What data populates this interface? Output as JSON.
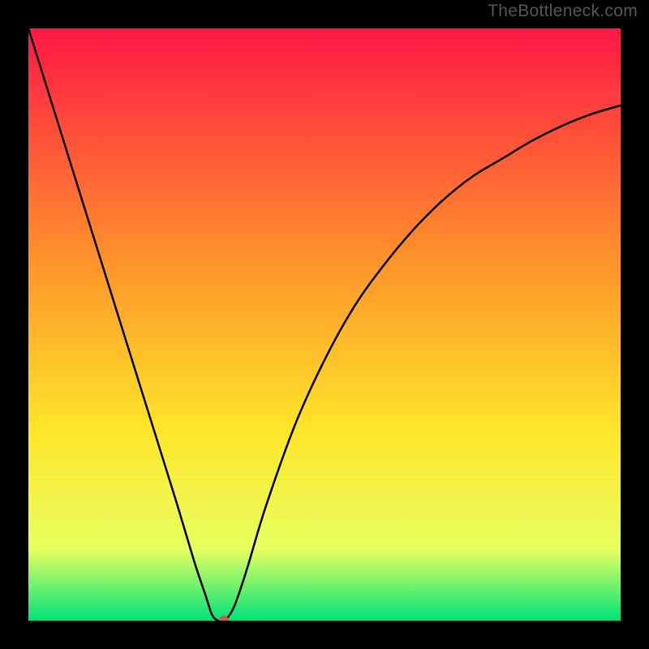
{
  "watermark": "TheBottleneck.com",
  "chart_data": {
    "type": "line",
    "title": "",
    "xlabel": "",
    "ylabel": "",
    "xlim": [
      0,
      100
    ],
    "ylim": [
      0,
      100
    ],
    "grid": false,
    "legend": false,
    "background_gradient": {
      "top": "#ff1746",
      "mid_upper": "#ff8f2b",
      "mid": "#ffe629",
      "mid_lower": "#e7ff60",
      "bottom": "#00e47a"
    },
    "series": [
      {
        "name": "bottleneck-curve",
        "x": [
          0,
          5,
          10,
          15,
          20,
          25,
          28,
          30,
          31,
          32,
          33,
          34,
          35,
          37,
          40,
          45,
          50,
          55,
          60,
          65,
          70,
          75,
          80,
          85,
          90,
          95,
          100
        ],
        "y": [
          100,
          84,
          68,
          52,
          36,
          20,
          10,
          4,
          1,
          0,
          0,
          1,
          3,
          9,
          19,
          33,
          44,
          53,
          60,
          66,
          71,
          75,
          78,
          81,
          83.5,
          85.5,
          87
        ]
      }
    ],
    "marker": {
      "x": 33,
      "y": 0,
      "color": "#cb5a4a",
      "radius_px": 6
    }
  }
}
